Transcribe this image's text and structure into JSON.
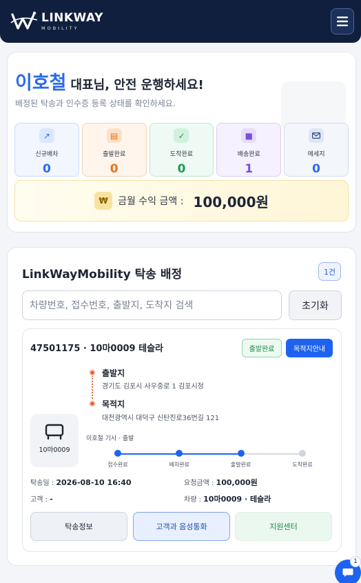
{
  "header": {
    "logo_text": "LINKWAY",
    "logo_sub": "MOBILITY"
  },
  "greeting": {
    "name": "이호철",
    "suffix": "대표님, 안전 운행하세요!",
    "subtitle": "배정된 탁송과 인수증 등록 상태를 확인하세요."
  },
  "stats": [
    {
      "label": "신규배차",
      "value": "0",
      "icon": "arrow-up-right-icon",
      "color": "#2b69f0"
    },
    {
      "label": "출발완료",
      "value": "0",
      "icon": "list-icon",
      "color": "#e8731e"
    },
    {
      "label": "도착완료",
      "value": "0",
      "icon": "check-icon",
      "color": "#1e9a55"
    },
    {
      "label": "배송완료",
      "value": "1",
      "icon": "square-icon",
      "color": "#7b4de0"
    },
    {
      "label": "메세지",
      "value": "0",
      "icon": "mail-icon",
      "color": "#2b69f0"
    }
  ],
  "revenue": {
    "icon_symbol": "₩",
    "label": "금월 수익 금액 :",
    "value": "100,000원"
  },
  "assignments": {
    "title": "LinkWayMobility 탁송 배정",
    "count_badge": "1건",
    "search_placeholder": "차량번호, 접수번호, 출발지, 도착지 검색",
    "reset_label": "초기화"
  },
  "job": {
    "title": "47501175 · 10마0009 테슬라",
    "status_chip": "출발완료",
    "nav_button": "목적지안내",
    "origin_title": "출발지",
    "origin_address": "경기도 김포시 사우중로 1 김포시청",
    "dest_title": "목적지",
    "dest_address": "대전광역시 대덕구 신탄진로36번길 121",
    "car_plate": "10마0009",
    "driver_status": "이호철 기사 · 출발",
    "progress": {
      "steps": [
        "접수완료",
        "배차완료",
        "출발완료",
        "도착완료"
      ],
      "completed_steps": 3
    },
    "date_label": "탁송일 :",
    "date_value": "2026-08-10 16:40",
    "fee_label": "요청금액 :",
    "fee_value": "100,000원",
    "customer_label": "고객 :",
    "customer_value": "-",
    "vehicle_label": "차량 :",
    "vehicle_value": "10마0009 · 테슬라",
    "btn_info": "탁송정보",
    "btn_call": "고객과 음성통화",
    "btn_support": "지원센터"
  },
  "chat": {
    "badge": "1"
  }
}
